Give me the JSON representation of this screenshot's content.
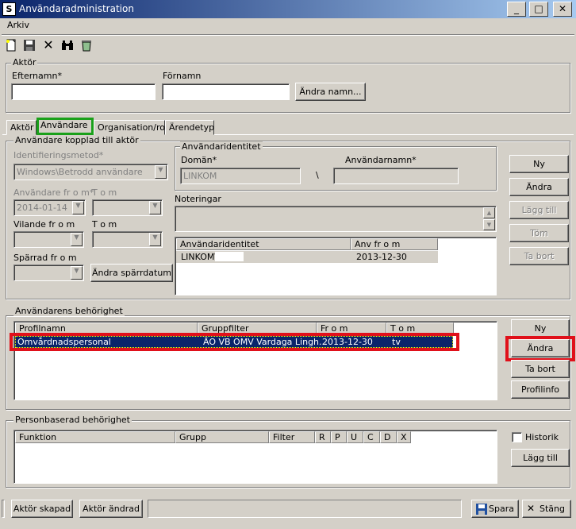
{
  "window": {
    "title": "Användaradministration",
    "icon": "app-icon",
    "min": "_",
    "max": "□",
    "close": "✕"
  },
  "menu": {
    "arkiv": "Arkiv"
  },
  "toolbar": {
    "new": "new-doc-icon",
    "save": "save-icon",
    "delete": "delete-icon",
    "find": "binoculars-icon",
    "recycle": "recycle-icon"
  },
  "aktor": {
    "title": "Aktör",
    "efternamn_label": "Efternamn*",
    "fornamn_label": "Förnamn",
    "andra_namn": "Ändra namn..."
  },
  "tabs": [
    "Aktör",
    "Användare",
    "Organisation/roll",
    "Ärendetyp"
  ],
  "anvandare": {
    "title": "Användare kopplad till aktör",
    "identifieringsmetod_label": "Identifieringsmetod*",
    "identifieringsmetod_value": "Windows\\Betrodd användare",
    "anv_from_label": "Användare fr o m*",
    "anv_tom_label": "T o m",
    "anv_from_value": "2014-01-14",
    "vilande_from_label": "Vilande fr o m",
    "vilande_tom_label": "T o m",
    "sparrad_label": "Spärrad fr o m",
    "andra_sparrdatum": "Ändra spärrdatum"
  },
  "identitet": {
    "title": "Användaridentitet",
    "doman_label": "Domän*",
    "doman_value": "LINKOM",
    "separator": "\\",
    "anvandarnamn_label": "Användarnamn*",
    "noteringar_label": "Noteringar",
    "list_headers": [
      "Användaridentitet",
      "Anv fr o m"
    ],
    "rows": [
      {
        "id": "LINKOM\\",
        "from": "2013-12-30"
      }
    ]
  },
  "side_buttons": {
    "ny": "Ny",
    "andra": "Ändra",
    "lagg_till": "Lägg till",
    "tom": "Töm",
    "ta_bort": "Ta bort"
  },
  "behorighet": {
    "title": "Användarens behörighet",
    "headers": [
      "Profilnamn",
      "Gruppfilter",
      "Fr o m",
      "T o m"
    ],
    "rows": [
      {
        "profil": "Omvårdnadspersonal",
        "grupp": "ÄO VB OMV Vardaga Lingh...",
        "from": "2013-12-30",
        "tom": "tv"
      }
    ],
    "buttons": {
      "ny": "Ny",
      "andra": "Ändra",
      "ta_bort": "Ta bort",
      "profilinfo": "Profilinfo"
    }
  },
  "person": {
    "title": "Personbaserad behörighet",
    "headers": [
      "Funktion",
      "Grupp",
      "Filter",
      "R",
      "P",
      "U",
      "C",
      "D",
      "X"
    ],
    "historik": "Historik",
    "lagg_till": "Lägg till"
  },
  "status": {
    "skapad": "Aktör skapad",
    "andrad": "Aktör ändrad",
    "spara": "Spara",
    "stang": "Stäng"
  },
  "highlight": {
    "green": "#1aa01a",
    "red": "#e0101a",
    "selection": "#0a246a"
  }
}
